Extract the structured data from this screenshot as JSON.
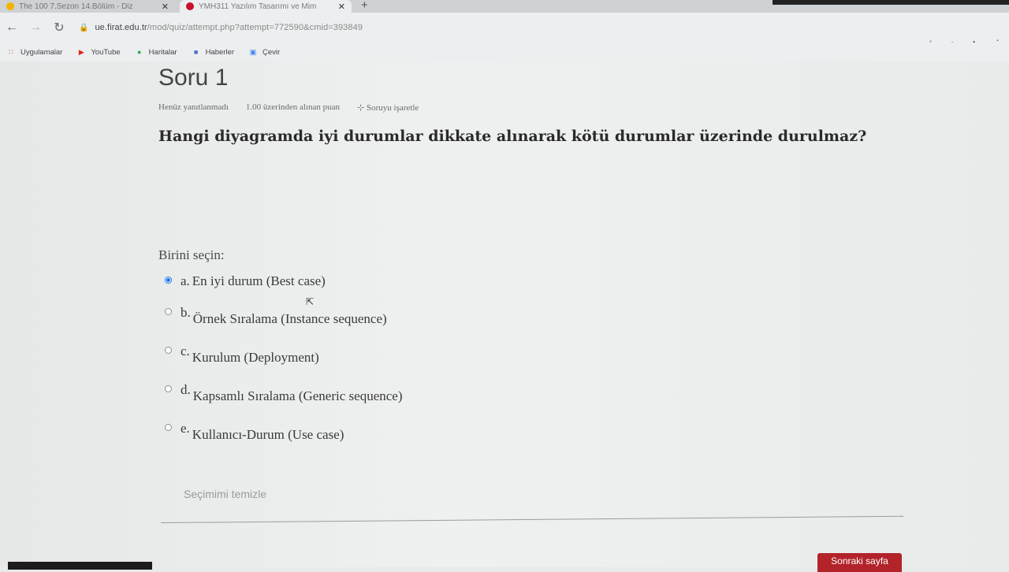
{
  "browser": {
    "tabs": [
      {
        "title": "The 100 7.Sezon 14.Bölüm - Diz",
        "close": "✕",
        "favicon_color": "#f2b400"
      },
      {
        "title": "YMH311 Yazılım Tasarımı ve Mim",
        "close": "✕",
        "favicon_color": "#c8102e"
      }
    ],
    "new_tab": "+",
    "url_host": "ue.firat.edu.tr",
    "url_path": "/mod/quiz/attempt.php?attempt=772590&cmid=393849",
    "bookmarks": [
      {
        "label": "Uygulamalar",
        "icon": "apps-grid-icon",
        "color": "#d93025"
      },
      {
        "label": "YouTube",
        "icon": "youtube-icon",
        "color": "#e62117"
      },
      {
        "label": "Haritalar",
        "icon": "maps-pin-icon",
        "color": "#34a853"
      },
      {
        "label": "Haberler",
        "icon": "news-icon",
        "color": "#4a6fd1"
      },
      {
        "label": "Çevir",
        "icon": "translate-icon",
        "color": "#4285f4"
      }
    ]
  },
  "question": {
    "title": "Soru 1",
    "status": "Henüz yanıtlanmadı",
    "marks": "1.00 üzerinden alınan puan",
    "flag": "Soruyu işaretle",
    "text": "Hangi diyagramda iyi durumlar dikkate alınarak kötü durumlar üzerinde durulmaz?",
    "prompt": "Birini seçin:",
    "options": [
      {
        "letter": "a.",
        "label": "En iyi durum (Best case)",
        "selected": true
      },
      {
        "letter": "b.",
        "label": "Örnek Sıralama (Instance sequence)",
        "selected": false
      },
      {
        "letter": "c.",
        "label": "Kurulum (Deployment)",
        "selected": false
      },
      {
        "letter": "d.",
        "label": "Kapsamlı Sıralama (Generic sequence)",
        "selected": false
      },
      {
        "letter": "e.",
        "label": "Kullanıcı-Durum (Use case)",
        "selected": false
      }
    ],
    "clear_label": "Seçimimi temizle",
    "next_label": "Sonraki sayfa"
  },
  "colors": {
    "accent": "#1a73e8",
    "next_button": "#b2242a"
  }
}
